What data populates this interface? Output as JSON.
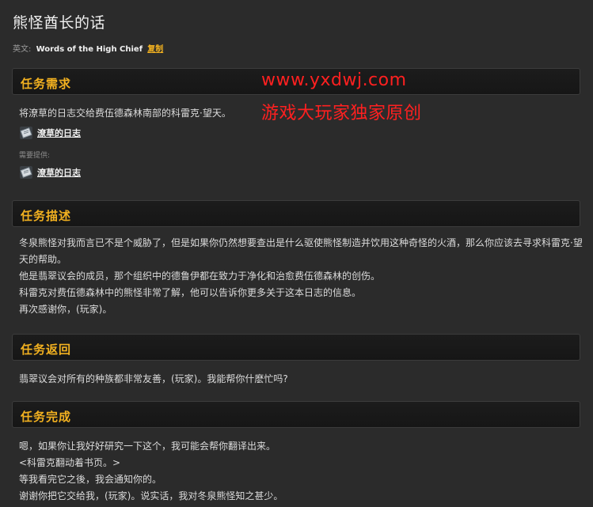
{
  "page_title": "熊怪酋长的话",
  "english": {
    "label": "英文:",
    "value": "Words of the High Chief",
    "copy_label": "复制"
  },
  "watermark": {
    "url": "www.yxdwj.com",
    "slogan": "游戏大玩家独家原创"
  },
  "sections": {
    "requirement": {
      "title": "任务需求",
      "text": "将潦草的日志交给费伍德森林南部的科雷克·望天。",
      "item_label": "潦草的日志",
      "provide_label": "需要提供:",
      "provided_item_label": "潦草的日志"
    },
    "description": {
      "title": "任务描述",
      "lines": [
        "冬泉熊怪对我而言已不是个威胁了，但是如果你仍然想要查出是什么驱使熊怪制造并饮用这种奇怪的火酒，那么你应该去寻求科雷克·望",
        "天的帮助。",
        "他是翡翠议会的成员，那个组织中的德鲁伊都在致力于净化和治愈费伍德森林的创伤。",
        "科雷克对费伍德森林中的熊怪非常了解，他可以告诉你更多关于这本日志的信息。",
        "再次感谢你，(玩家)。"
      ]
    },
    "return": {
      "title": "任务返回",
      "text": "翡翠议会对所有的种族都非常友善，(玩家)。我能帮你什麽忙吗?"
    },
    "complete": {
      "title": "任务完成",
      "lines": [
        "嗯，如果你让我好好研究一下这个，我可能会帮你翻译出来。",
        "<科雷克翻动着书页。>",
        "等我看完它之後，我会通知你的。",
        "谢谢你把它交给我，(玩家)。说实话，我对冬泉熊怪知之甚少。"
      ]
    }
  },
  "colors": {
    "accent": "#f2b120",
    "background": "#2b2b2b",
    "header_bg": "#1a1a1a",
    "watermark": "#ff2020"
  },
  "icons": {
    "item": "book-icon"
  }
}
